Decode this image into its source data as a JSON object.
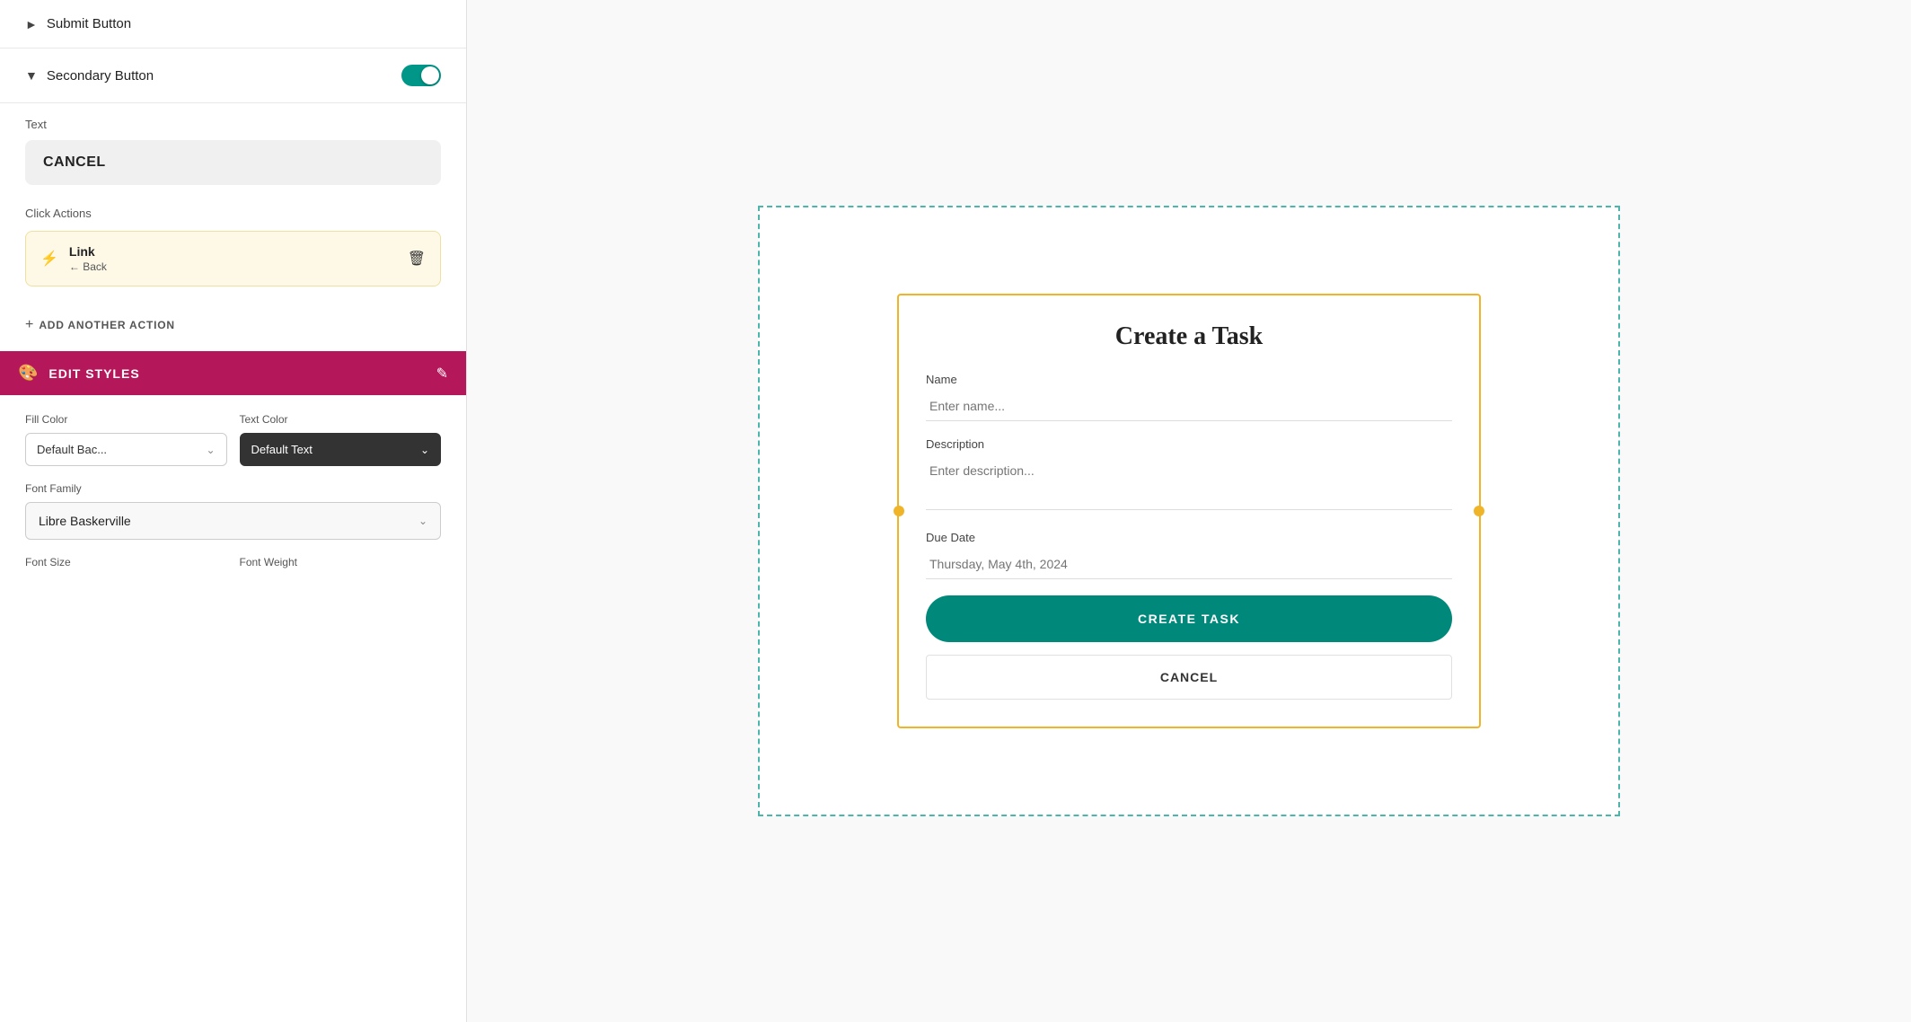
{
  "leftPanel": {
    "submitButton": {
      "label": "Submit Button"
    },
    "secondaryButton": {
      "label": "Secondary Button",
      "toggleEnabled": true
    },
    "textSection": {
      "label": "Text",
      "value": "CANCEL"
    },
    "clickActions": {
      "label": "Click Actions",
      "action": {
        "name": "Link",
        "sub": "← Back"
      },
      "addLabel": "ADD ANOTHER ACTION"
    },
    "editStyles": {
      "header": "EDIT STYLES",
      "fillColor": {
        "label": "Fill Color",
        "value": "Default Bac..."
      },
      "textColor": {
        "label": "Text Color",
        "value": "Default Text"
      },
      "fontFamily": {
        "label": "Font Family",
        "value": "Libre Baskerville"
      },
      "fontSize": {
        "label": "Font Size"
      },
      "fontWeight": {
        "label": "Font Weight"
      }
    }
  },
  "rightPanel": {
    "form": {
      "title": "Create a Task",
      "fields": [
        {
          "label": "Name",
          "placeholder": "Enter name...",
          "type": "input"
        },
        {
          "label": "Description",
          "placeholder": "Enter description...",
          "type": "textarea"
        },
        {
          "label": "Due Date",
          "placeholder": "Thursday, May 4th, 2024",
          "type": "input"
        }
      ],
      "submitButton": "CREATE TASK",
      "cancelButton": "CANCEL"
    }
  }
}
